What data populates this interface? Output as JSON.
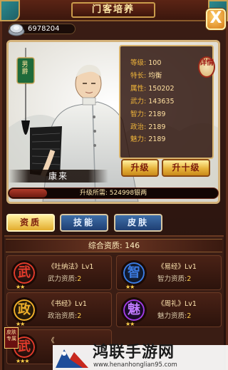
{
  "window": {
    "title": "门客培养",
    "close_label": "X"
  },
  "silver": {
    "icon": "silver-coin-icon",
    "value": "6978204"
  },
  "hero": {
    "name": "康来",
    "gender_tag": "男",
    "gender_tag2": "爵",
    "detail_label": "详情",
    "stats": [
      {
        "key": "等级:",
        "value": "100"
      },
      {
        "key": "特长:",
        "value": "均衡"
      },
      {
        "key": "属性:",
        "value": "150202"
      },
      {
        "key": "武力:",
        "value": "143635"
      },
      {
        "key": "智力:",
        "value": "2189"
      },
      {
        "key": "政治:",
        "value": "2189"
      },
      {
        "key": "魅力:",
        "value": "2189"
      }
    ],
    "upgrade_label": "升级",
    "upgrade10_label": "升十级",
    "upgrade_cost_label": "升级所需:",
    "upgrade_cost_value": "524998银两",
    "upgrade_progress": 0.18
  },
  "tabs": [
    {
      "label": "资质",
      "active": true
    },
    {
      "label": "技能",
      "active": false
    },
    {
      "label": "皮肤",
      "active": false
    }
  ],
  "aptitude": {
    "total_label": "综合资质:",
    "total_value": "146",
    "skills": [
      {
        "glyph": "武",
        "name": "《吐纳法》",
        "level": "Lv1",
        "attr": "武力资质:",
        "value": "2",
        "stars": "★★",
        "color": "#e23b2b"
      },
      {
        "glyph": "智",
        "name": "《易经》",
        "level": "Lv1",
        "attr": "智力资质:",
        "value": "2",
        "stars": "★★",
        "color": "#3b7be2"
      },
      {
        "glyph": "政",
        "name": "《书经》",
        "level": "Lv1",
        "attr": "政治资质:",
        "value": "2",
        "stars": "★★",
        "color": "#f0b02a"
      },
      {
        "glyph": "魅",
        "name": "《周礼》",
        "level": "Lv1",
        "attr": "魅力资质:",
        "value": "2",
        "stars": "★★",
        "color": "#a03be2"
      },
      {
        "glyph": "武",
        "name": "《",
        "level": "",
        "attr": "",
        "value": "",
        "stars": "★★★",
        "color": "#e23b2b"
      }
    ],
    "badge_text": "皮肤专属"
  },
  "watermark": {
    "title": "鸿联手游网",
    "url": "www.henanhonglian95.com"
  }
}
